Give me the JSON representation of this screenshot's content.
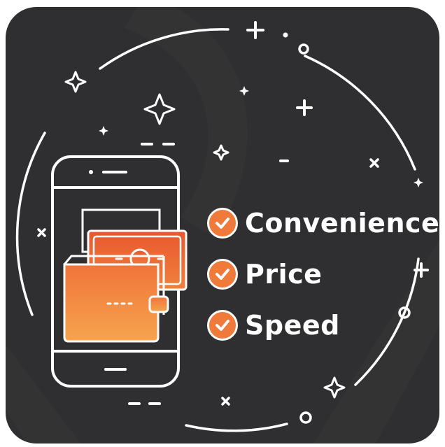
{
  "features": [
    {
      "label": "Convenience",
      "icon": "check-circle-icon"
    },
    {
      "label": "Price",
      "icon": "check-circle-icon"
    },
    {
      "label": "Speed",
      "icon": "check-circle-icon"
    }
  ],
  "colors": {
    "background": "#2f2f31",
    "accent_orange": "#f07a3a",
    "accent_orange_light": "#f5a25a",
    "line_white": "#ffffff"
  },
  "illustration": {
    "device": "smartphone-icon",
    "content": "wallet-and-cash-icon",
    "decorations": [
      "sparkle-icon",
      "plus-icon",
      "cross-icon",
      "circle-dot-icon"
    ]
  }
}
